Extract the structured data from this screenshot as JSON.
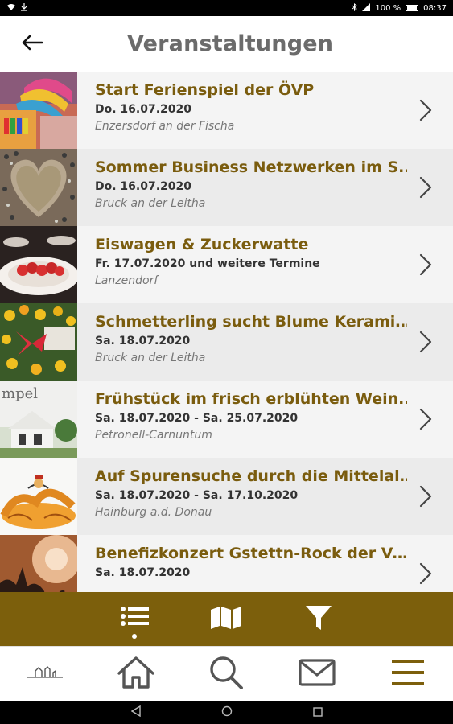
{
  "status_bar": {
    "battery": "100 %",
    "time": "08:37"
  },
  "header": {
    "title": "Veranstaltungen"
  },
  "events": [
    {
      "title": "Start Ferienspiel der ÖVP",
      "date": "Do. 16.07.2020",
      "location": "Enzersdorf an der Fischa"
    },
    {
      "title": "Sommer Business Netzwerken im S...",
      "date": "Do. 16.07.2020",
      "location": "Bruck an der Leitha"
    },
    {
      "title": "Eiswagen & Zuckerwatte",
      "date": "Fr. 17.07.2020 und weitere Termine",
      "location": "Lanzendorf"
    },
    {
      "title": "Schmetterling sucht Blume Keramik...",
      "date": "Sa. 18.07.2020",
      "location": "Bruck an der Leitha"
    },
    {
      "title": "Frühstück im frisch erblühten Wein...",
      "date": "Sa. 18.07.2020 - Sa. 25.07.2020",
      "location": "Petronell-Carnuntum"
    },
    {
      "title": "Auf Spurensuche durch die Mittelalt...",
      "date": "Sa. 18.07.2020 - Sa. 17.10.2020",
      "location": "Hainburg a.d. Donau"
    },
    {
      "title": "Benefizkonzert Gstettn-Rock der Vo...",
      "date": "Sa. 18.07.2020",
      "location": ""
    }
  ],
  "thumb_text": {
    "item5": "mpel"
  },
  "colors": {
    "accent": "#7c5f0c",
    "title_text": "#7a5c0e",
    "header_text": "#6b6b6b",
    "row_light": "#f4f4f4",
    "row_dark": "#ebebeb"
  },
  "icons": {
    "back": "arrow-left-icon",
    "list": "list-icon",
    "map": "map-icon",
    "filter": "filter-icon",
    "logo": "logo-icon",
    "home": "home-icon",
    "search": "search-icon",
    "mail": "mail-icon",
    "menu": "menu-icon"
  }
}
